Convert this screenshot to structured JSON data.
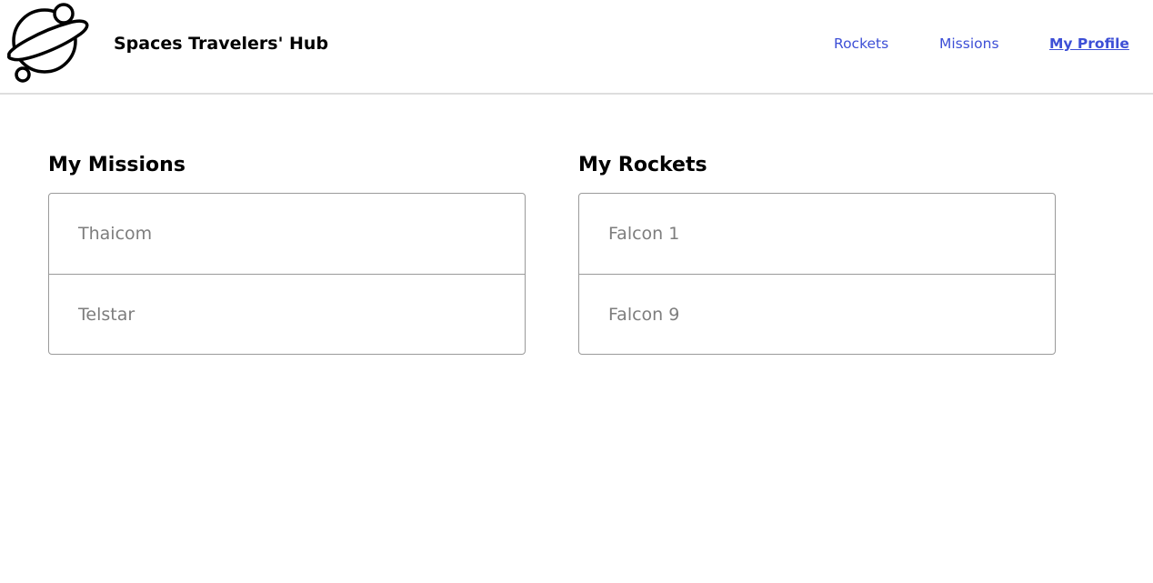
{
  "header": {
    "brand": "Spaces Travelers' Hub",
    "logo_icon": "planet-logo-icon",
    "nav": {
      "rockets": "Rockets",
      "missions": "Missions",
      "profile": "My Profile"
    },
    "active_nav": "profile",
    "accent_color": "#3d4fd6"
  },
  "missions": {
    "title": "My Missions",
    "items": [
      "Thaicom",
      "Telstar"
    ]
  },
  "rockets": {
    "title": "My Rockets",
    "items": [
      "Falcon 1",
      "Falcon 9"
    ]
  }
}
